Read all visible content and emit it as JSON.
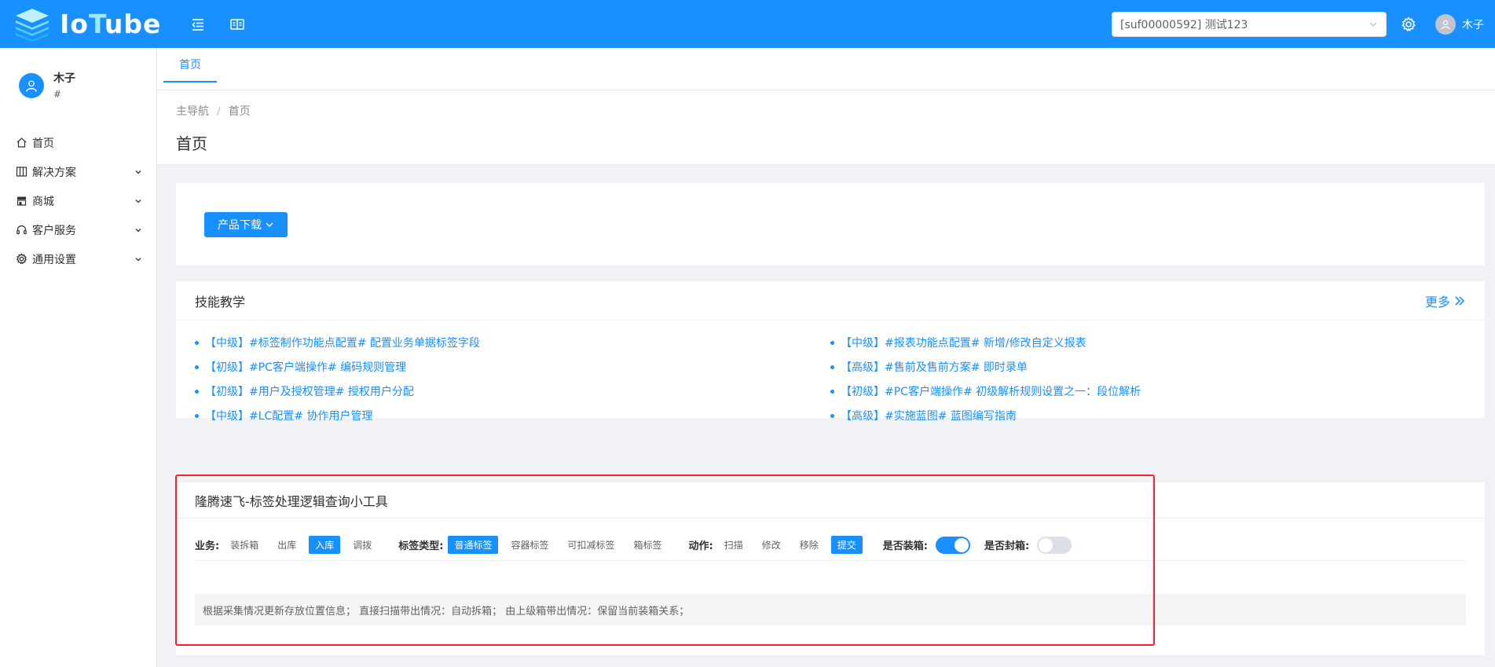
{
  "app": {
    "logo_text_a": "Io",
    "logo_text_b": "T",
    "logo_text_c": "ube",
    "tenant_select_value": "[suf00000592] 测试123",
    "user_name": "木子"
  },
  "sidebar": {
    "user_name": "木子",
    "user_sub": "#",
    "items": [
      {
        "label": "首页",
        "icon": "home-icon",
        "has_children": false
      },
      {
        "label": "解决方案",
        "icon": "solution-icon",
        "has_children": true
      },
      {
        "label": "商城",
        "icon": "shop-icon",
        "has_children": true
      },
      {
        "label": "客户服务",
        "icon": "headset-icon",
        "has_children": true
      },
      {
        "label": "通用设置",
        "icon": "gear-icon",
        "has_children": true
      }
    ]
  },
  "tabs": [
    {
      "label": "首页"
    }
  ],
  "breadcrumb": {
    "root": "主导航",
    "sep": "/",
    "current": "首页"
  },
  "page_title": "首页",
  "download": {
    "button_label": "产品下载"
  },
  "skills": {
    "title": "技能教学",
    "more_label": "更多",
    "left": [
      "【中级】#标签制作功能点配置# 配置业务单据标签字段",
      "【初级】#PC客户端操作# 编码规则管理",
      "【初级】#用户及授权管理# 授权用户分配",
      "【中级】#LC配置# 协作用户管理"
    ],
    "right": [
      "【中级】#报表功能点配置# 新增/修改自定义报表",
      "【高级】#售前及售前方案# 即时录单",
      "【初级】#PC客户端操作# 初级解析规则设置之一：段位解析",
      "【高级】#实施蓝图# 蓝图编写指南"
    ]
  },
  "tool": {
    "title": "隆腾速飞-标签处理逻辑查询小工具",
    "business": {
      "label": "业务:",
      "options": [
        "装拆箱",
        "出库",
        "入库",
        "调拨"
      ],
      "active": 2
    },
    "tag_type": {
      "label": "标签类型:",
      "options": [
        "普通标签",
        "容器标签",
        "可扣减标签",
        "箱标签"
      ],
      "active": 0
    },
    "action": {
      "label": "动作:",
      "options": [
        "扫描",
        "修改",
        "移除",
        "提交"
      ],
      "active": 3
    },
    "is_packing": {
      "label": "是否装箱:",
      "on": true
    },
    "is_sealing": {
      "label": "是否封箱:",
      "on": false
    },
    "result_text": "根据采集情况更新存放位置信息；  直接扫描带出情况：自动拆箱；  由上级箱带出情况：保留当前装箱关系；"
  },
  "colors": {
    "primary": "#1890ff",
    "highlight": "#f5222d"
  }
}
